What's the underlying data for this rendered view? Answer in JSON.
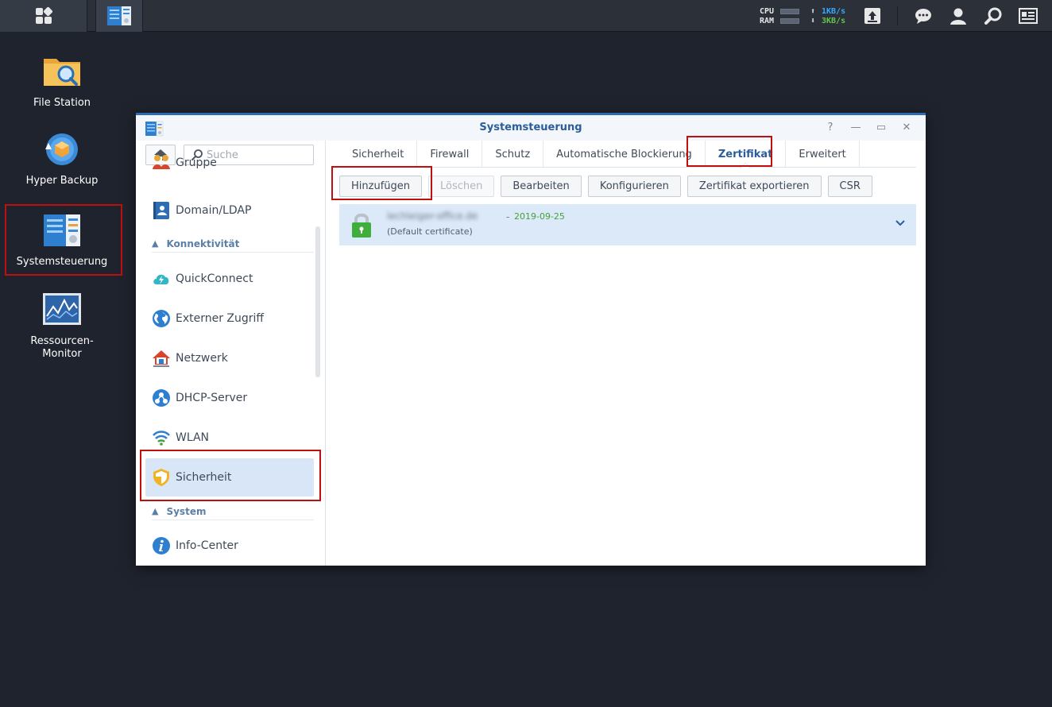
{
  "taskbar": {
    "cpu_label": "CPU",
    "ram_label": "RAM",
    "upload_arrow": "⬆",
    "download_arrow": "⬇",
    "upload_rate": "1KB/s",
    "download_rate": "3KB/s"
  },
  "desktop": {
    "file_station": "File Station",
    "hyper_backup": "Hyper Backup",
    "systemsteuerung": "Systemsteuerung",
    "ressourcen_line1": "Ressourcen-",
    "ressourcen_line2": "Monitor"
  },
  "window": {
    "title": "Systemsteuerung",
    "help": "?",
    "minimize": "—",
    "maximize": "▭",
    "close": "✕"
  },
  "sidebar": {
    "search_placeholder": "Suche",
    "items": {
      "gruppe": "Gruppe",
      "domain": "Domain/LDAP",
      "quickconnect": "QuickConnect",
      "externer_zugriff": "Externer Zugriff",
      "netzwerk": "Netzwerk",
      "dhcp": "DHCP-Server",
      "wlan": "WLAN",
      "sicherheit": "Sicherheit",
      "info_center": "Info-Center"
    },
    "sections": {
      "konnektivitaet": "Konnektivität",
      "system": "System"
    }
  },
  "tabs": [
    "Sicherheit",
    "Firewall",
    "Schutz",
    "Automatische Blockierung",
    "Zertifikat",
    "Erweitert"
  ],
  "toolbar": {
    "add": "Hinzufügen",
    "delete": "Löschen",
    "edit": "Bearbeiten",
    "configure": "Konfigurieren",
    "export": "Zertifikat exportieren",
    "csr": "CSR"
  },
  "certificate": {
    "name": "lechleiger-office.de",
    "separator": "-",
    "date": "2019-09-25",
    "description": "(Default certificate)"
  },
  "colors": {
    "accent": "#2a5d9a",
    "highlight": "#c00f0f",
    "active_bg": "#d8e6f7",
    "date_green": "#45a13a"
  }
}
